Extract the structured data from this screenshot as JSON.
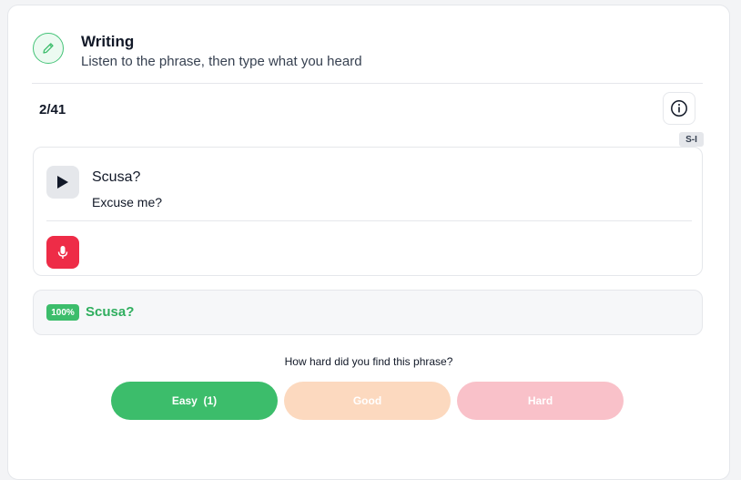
{
  "header": {
    "title": "Writing",
    "subtitle": "Listen to the phrase, then type what you heard",
    "icon": "pencil-icon"
  },
  "progress": {
    "counter": "2/41"
  },
  "tag": "S-I",
  "phrase": {
    "text": "Scusa?",
    "translation": "Excuse me?"
  },
  "result": {
    "score": "100%",
    "text": "Scusa?"
  },
  "rating": {
    "question": "How hard did you find this phrase?",
    "buttons": [
      {
        "label": "Easy  (1)",
        "color": "#3cbd6b"
      },
      {
        "label": "Good",
        "color": "#fcd9bf"
      },
      {
        "label": "Hard",
        "color": "#f9c1c9"
      }
    ]
  },
  "colors": {
    "accent_green": "#3cbd6b",
    "mic_red": "#ee2c47"
  }
}
